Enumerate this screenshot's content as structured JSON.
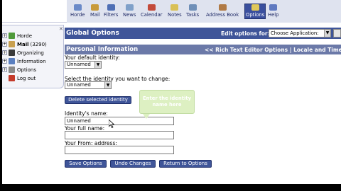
{
  "nav": {
    "items": [
      {
        "label": "Horde",
        "icon": "horde-icon",
        "color": "#6a8ac8"
      },
      {
        "label": "Mail",
        "icon": "mail-icon",
        "color": "#c89a3a"
      },
      {
        "label": "Filters",
        "icon": "filter-icon",
        "color": "#4f6fb5"
      },
      {
        "label": "News",
        "icon": "news-icon",
        "color": "#7fa0c9"
      },
      {
        "label": "Calendar",
        "icon": "calendar-icon",
        "color": "#c34a3a"
      },
      {
        "label": "Notes",
        "icon": "notes-icon",
        "color": "#d9c055"
      },
      {
        "label": "Tasks",
        "icon": "tasks-icon",
        "color": "#6f8fb8"
      },
      {
        "label": "Address Book",
        "icon": "address-book-icon",
        "color": "#b07a45"
      },
      {
        "label": "Options",
        "icon": "options-icon",
        "color": "#e0c95a",
        "active": true
      },
      {
        "label": "Help",
        "icon": "help-icon",
        "color": "#5f79c0"
      }
    ]
  },
  "sidebar": {
    "items": [
      {
        "label": "Horde",
        "icon": "horde-icon",
        "color": "#4f9a3a"
      },
      {
        "label": "Mail",
        "count": "(3290)",
        "icon": "mail-icon",
        "color": "#c8a050"
      },
      {
        "label": "Organizing",
        "icon": "organizing-icon",
        "color": "#3a3a3a"
      },
      {
        "label": "Information",
        "icon": "information-icon",
        "color": "#5a7fc0"
      },
      {
        "label": "Options",
        "icon": "options-icon",
        "color": "#8a8a8a"
      },
      {
        "label": "Log out",
        "icon": "logout-icon",
        "color": "#c43a2a"
      }
    ]
  },
  "header": {
    "title": "Global Options",
    "edit_label": "Edit options for:",
    "app_select": "Choose Application:"
  },
  "section": {
    "title": "Personal Information",
    "links": "<< Rich Text Editor Options | Locale and Time >>"
  },
  "form": {
    "default_identity_label": "Your default identity:",
    "default_identity_value": "Unnamed",
    "select_identity_label": "Select the identity you want to change:",
    "select_identity_value": "Unnamed",
    "delete_button": "Delete selected identity",
    "identity_name_label": "Identity's name:",
    "identity_name_value": "Unnamed",
    "full_name_label": "Your full name:",
    "full_name_value": "",
    "from_address_label": "Your From: address:",
    "from_address_value": "",
    "tooltip": "Enter the identity name here"
  },
  "actions": {
    "save": "Save Options",
    "undo": "Undo Changes",
    "return": "Return to Options"
  },
  "colors": {
    "header_blue": "#3f5599",
    "section_blue": "#6b79a8",
    "tooltip_green": "#ddf0c2"
  }
}
